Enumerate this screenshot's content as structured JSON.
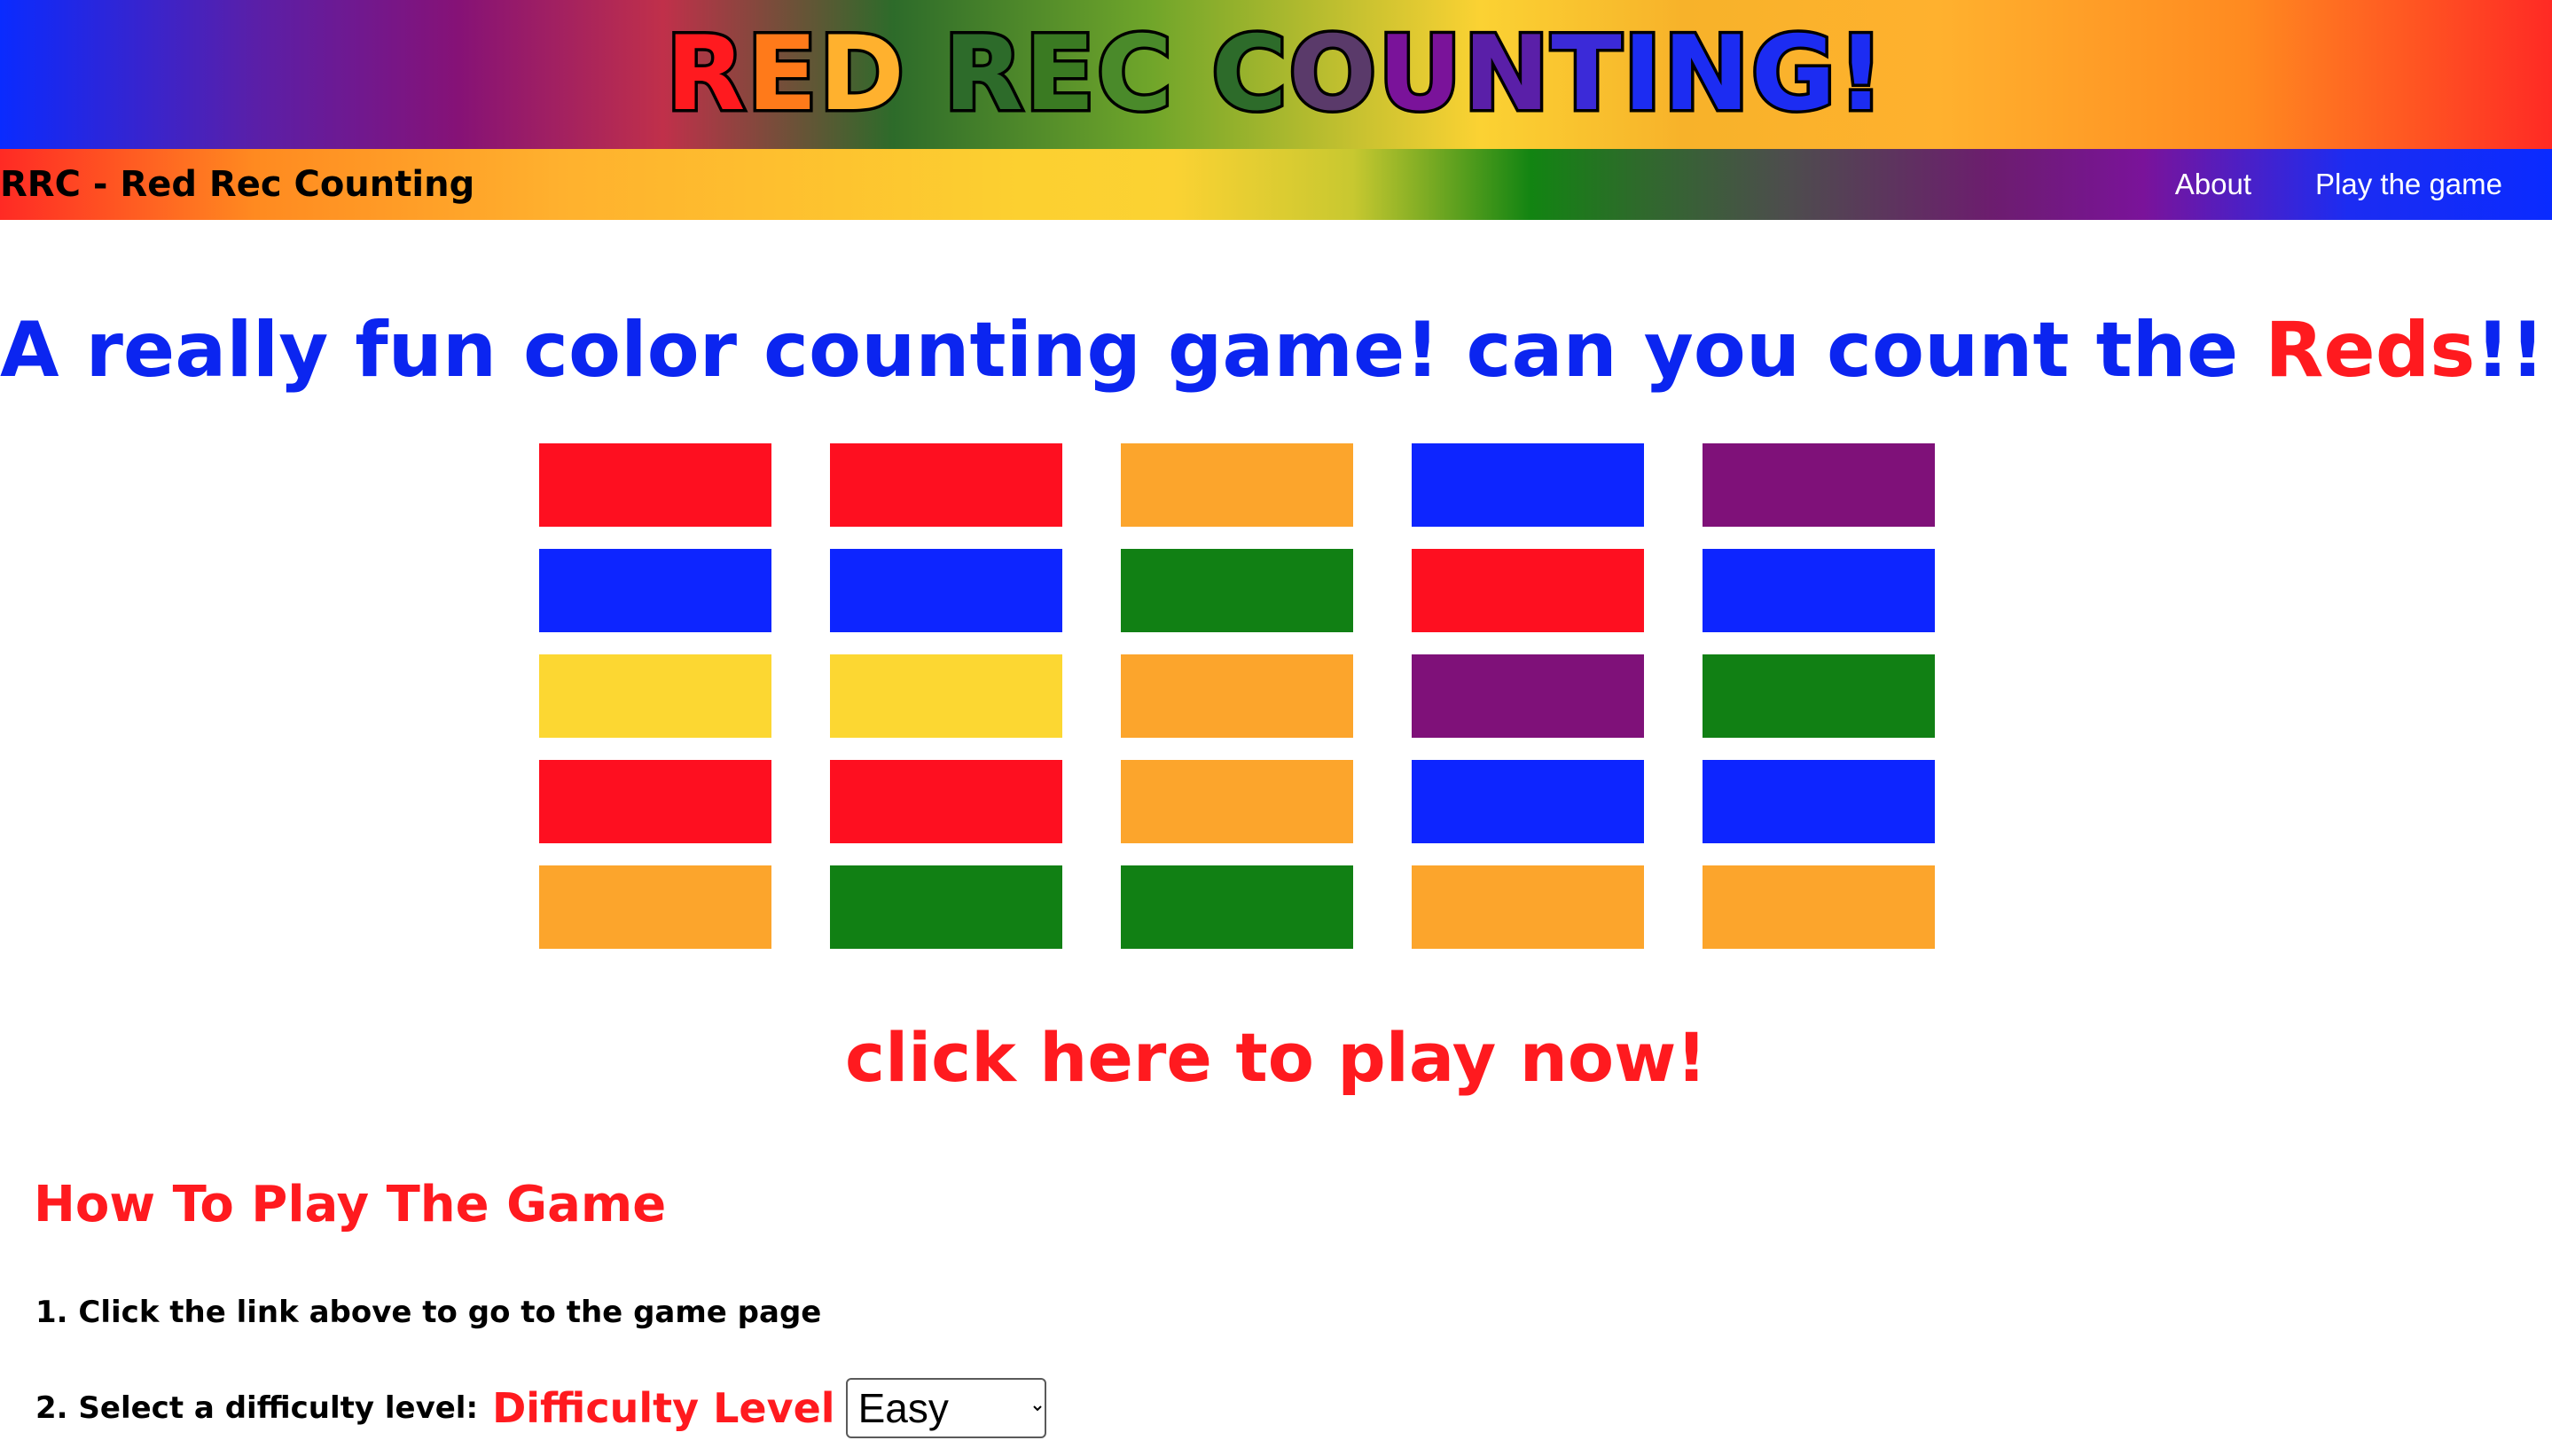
{
  "banner": {
    "title": "RED REC COUNTING!"
  },
  "title_colors": [
    "#ff1a1f",
    "#ff7a1a",
    "#ffb12e",
    "#2d6b2a",
    "#3a7a22",
    "#4a8a2a",
    "#2d6b2a",
    "#5a3a6a",
    "#7a139a",
    "#5a1fa8",
    "#3b2ad8",
    "#1c2cf2"
  ],
  "nav": {
    "brand": "RRC - Red Rec Counting",
    "links": [
      {
        "label": "About"
      },
      {
        "label": "Play the game"
      }
    ]
  },
  "headline": {
    "text": "A really fun color counting game! can you count the ",
    "highlight": "Reds",
    "suffix": "!!!"
  },
  "grid": {
    "rows": [
      [
        "red",
        "red",
        "orange",
        "blue",
        "purple"
      ],
      [
        "blue",
        "blue",
        "green",
        "red",
        "blue"
      ],
      [
        "yellow",
        "yellow",
        "orange",
        "purple",
        "green"
      ],
      [
        "red",
        "red",
        "orange",
        "blue",
        "blue"
      ],
      [
        "orange",
        "green",
        "green",
        "orange",
        "orange"
      ]
    ]
  },
  "colors": {
    "red": "#fe0f20",
    "blue": "#0d25ff",
    "orange": "#fca52c",
    "purple": "#7f1179",
    "green": "#118014",
    "yellow": "#fcd732",
    "accent_red": "#ff1a1f",
    "accent_blue": "#0b25f0"
  },
  "cta": {
    "label": "click here to play now!"
  },
  "how_to_play": {
    "heading": "How To Play The Game",
    "step1": "1. Click the link above to go to the game page",
    "step2_prefix": "2. Select a difficulty level:",
    "difficulty_label": "Difficulty Level",
    "difficulty_selected": "Easy"
  }
}
